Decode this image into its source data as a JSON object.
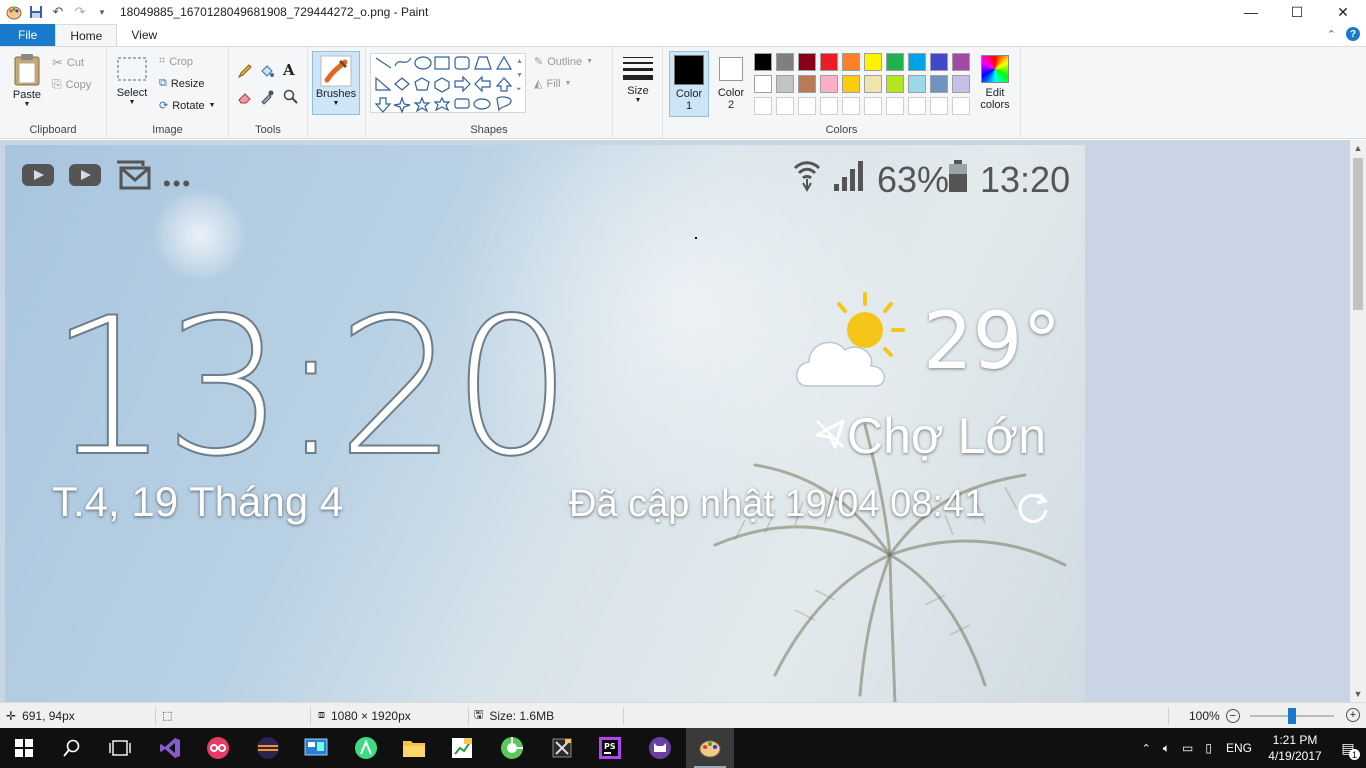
{
  "window": {
    "title": "18049885_1670128049681908_729444272_o.png - Paint",
    "controls": {
      "minimize": "—",
      "maximize": "☐",
      "close": "✕"
    }
  },
  "tabs": {
    "file": "File",
    "home": "Home",
    "view": "View"
  },
  "ribbon": {
    "clipboard": {
      "label": "Clipboard",
      "paste": "Paste",
      "cut": "Cut",
      "copy": "Copy"
    },
    "image": {
      "label": "Image",
      "select": "Select",
      "crop": "Crop",
      "resize": "Resize",
      "rotate": "Rotate"
    },
    "tools": {
      "label": "Tools"
    },
    "brushes": {
      "label": "Brushes"
    },
    "shapes": {
      "label": "Shapes",
      "outline": "Outline",
      "fill": "Fill"
    },
    "size": {
      "label": "Size"
    },
    "colors": {
      "label": "Colors",
      "color1": "Color\n1",
      "color1_line1": "Color",
      "color1_line2": "1",
      "color2_line1": "Color",
      "color2_line2": "2",
      "edit_line1": "Edit",
      "edit_line2": "colors",
      "row1": [
        "#000000",
        "#7f7f7f",
        "#880015",
        "#ed1c24",
        "#ff7f27",
        "#fff200",
        "#22b14c",
        "#00a2e8",
        "#3f48cc",
        "#a349a4"
      ],
      "row2": [
        "#ffffff",
        "#c3c3c3",
        "#b97a57",
        "#ffaec9",
        "#ffc90e",
        "#efe4b0",
        "#b5e61d",
        "#99d9ea",
        "#7092be",
        "#c8bfe7"
      ]
    }
  },
  "canvas": {
    "status": {
      "battery": "63%",
      "time": "13:20"
    },
    "clock": "13:20",
    "date": "T.4, 19 Tháng 4",
    "temperature": "29°",
    "location": "Chợ Lớn",
    "updated": "Đã cập nhật 19/04  08:41"
  },
  "statusbar": {
    "cursor": "691, 94px",
    "dimensions": "1080 × 1920px",
    "size": "Size: 1.6MB",
    "zoom": "100%"
  },
  "taskbar": {
    "tray_lang": "ENG",
    "time": "1:21 PM",
    "date": "4/19/2017",
    "notification_count": "1"
  }
}
